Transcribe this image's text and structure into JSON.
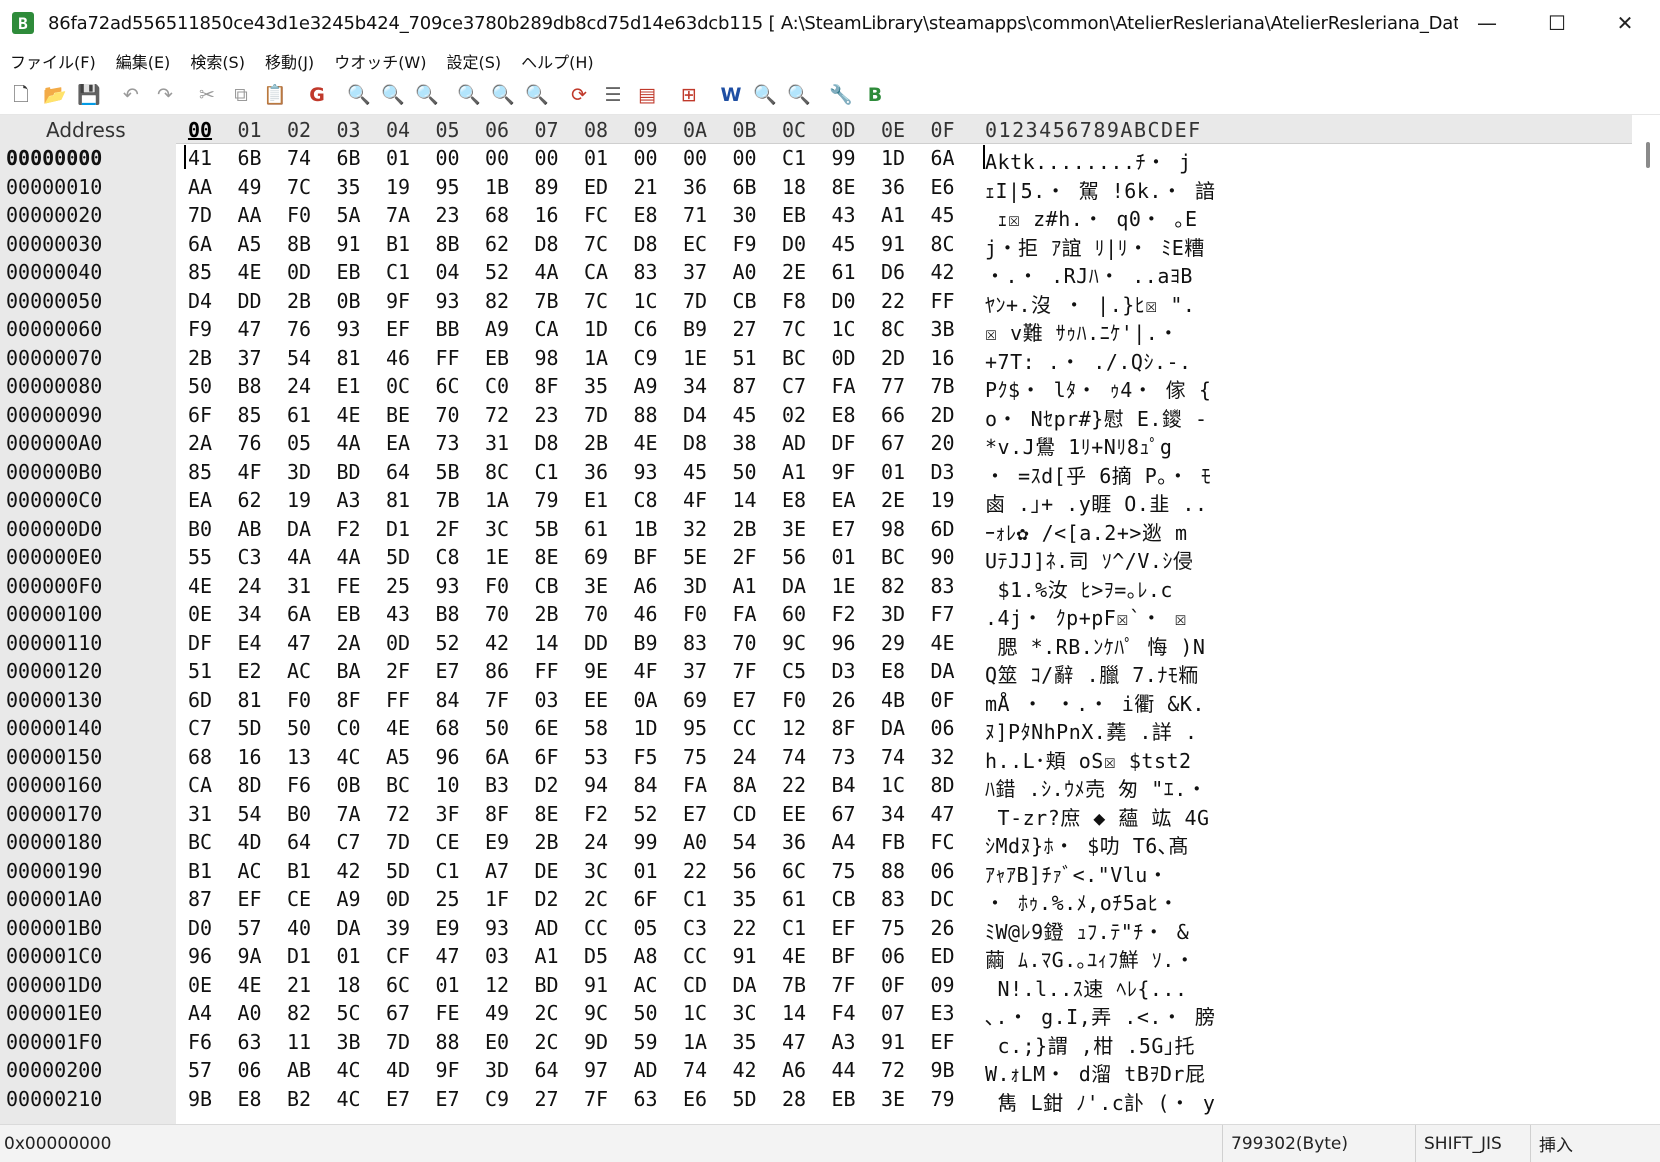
{
  "window": {
    "title": "86fa72ad556511850ce43d1e3245b424_709ce3780b289db8cd75d14e63dcb115 [ A:\\SteamLibrary\\steamapps\\common\\AtelierResleriana\\AtelierResleriana_Data\\ABCache\\Bundl...",
    "app_icon": "B",
    "minimize": "—",
    "maximize": "☐",
    "close": "✕"
  },
  "menu": [
    "ファイル(F)",
    "編集(E)",
    "検索(S)",
    "移動(J)",
    "ウオッチ(W)",
    "設定(S)",
    "ヘルプ(H)"
  ],
  "toolbar": [
    {
      "icon": "new-file-icon",
      "glyph": "🗋",
      "color": "#333333"
    },
    {
      "icon": "open-folder-icon",
      "glyph": "📂",
      "color": "#c59a1a"
    },
    {
      "icon": "save-icon",
      "glyph": "💾",
      "color": "#777777"
    },
    {
      "icon": "sep"
    },
    {
      "icon": "undo-icon",
      "glyph": "↶",
      "color": "#9a9a9a"
    },
    {
      "icon": "redo-icon",
      "glyph": "↷",
      "color": "#9a9a9a"
    },
    {
      "icon": "sep"
    },
    {
      "icon": "cut-icon",
      "glyph": "✂",
      "color": "#9a9a9a"
    },
    {
      "icon": "copy-icon",
      "glyph": "⧉",
      "color": "#9a9a9a"
    },
    {
      "icon": "paste-icon",
      "glyph": "📋",
      "color": "#777777"
    },
    {
      "icon": "sep"
    },
    {
      "icon": "goto-icon",
      "glyph": "G",
      "color": "#c0392b"
    },
    {
      "icon": "sep"
    },
    {
      "icon": "find-icon",
      "glyph": "🔍",
      "color": "#1f4fa3"
    },
    {
      "icon": "find-next-icon",
      "glyph": "🔍",
      "color": "#9a9a9a"
    },
    {
      "icon": "find-prev-icon",
      "glyph": "🔍",
      "color": "#9a9a9a"
    },
    {
      "icon": "sep"
    },
    {
      "icon": "replace-icon",
      "glyph": "🔍",
      "color": "#c0392b"
    },
    {
      "icon": "replace-next-icon",
      "glyph": "🔍",
      "color": "#9a9a9a"
    },
    {
      "icon": "replace-prev-icon",
      "glyph": "🔍",
      "color": "#9a9a9a"
    },
    {
      "icon": "sep"
    },
    {
      "icon": "compare-icon",
      "glyph": "⟳",
      "color": "#c0392b"
    },
    {
      "icon": "list-icon",
      "glyph": "☰",
      "color": "#666666"
    },
    {
      "icon": "clipboard-icon",
      "glyph": "▤",
      "color": "#c0392b"
    },
    {
      "icon": "sep"
    },
    {
      "icon": "struct-icon",
      "glyph": "⊞",
      "color": "#c0392b"
    },
    {
      "icon": "sep"
    },
    {
      "icon": "watch-icon",
      "glyph": "W",
      "color": "#1f4fa3"
    },
    {
      "icon": "watch-find-icon",
      "glyph": "🔍",
      "color": "#9a9a9a"
    },
    {
      "icon": "watch-find2-icon",
      "glyph": "🔍",
      "color": "#9a9a9a"
    },
    {
      "icon": "sep"
    },
    {
      "icon": "settings-icon",
      "glyph": "🔧",
      "color": "#1f4fa3"
    },
    {
      "icon": "bz-icon",
      "glyph": "B",
      "color": "#2e8b3a"
    }
  ],
  "hex_header": {
    "address_label": "Address",
    "columns": [
      "00",
      "01",
      "02",
      "03",
      "04",
      "05",
      "06",
      "07",
      "08",
      "09",
      "0A",
      "0B",
      "0C",
      "0D",
      "0E",
      "0F"
    ],
    "ascii_label": "0123456789ABCDEF"
  },
  "rows": [
    {
      "addr": "00000000",
      "bytes": [
        "41",
        "6B",
        "74",
        "6B",
        "01",
        "00",
        "00",
        "00",
        "01",
        "00",
        "00",
        "00",
        "C1",
        "99",
        "1D",
        "6A"
      ],
      "ascii": "Aktk........ﾁ・ j"
    },
    {
      "addr": "00000010",
      "bytes": [
        "AA",
        "49",
        "7C",
        "35",
        "19",
        "95",
        "1B",
        "89",
        "ED",
        "21",
        "36",
        "6B",
        "18",
        "8E",
        "36",
        "E6"
      ],
      "ascii": "ｪI|5.・ 駕 !6k.・ 諳"
    },
    {
      "addr": "00000020",
      "bytes": [
        "7D",
        "AA",
        "F0",
        "5A",
        "7A",
        "23",
        "68",
        "16",
        "FC",
        "E8",
        "71",
        "30",
        "EB",
        "43",
        "A1",
        "45"
      ],
      "ascii": " ｪ☒ z#h.・ q0・ ｡E"
    },
    {
      "addr": "00000030",
      "bytes": [
        "6A",
        "A5",
        "8B",
        "91",
        "B1",
        "8B",
        "62",
        "D8",
        "7C",
        "D8",
        "EC",
        "F9",
        "D0",
        "45",
        "91",
        "8C"
      ],
      "ascii": "j・拒 ｱ誼 ﾘ|ﾘ・ ﾐE糟"
    },
    {
      "addr": "00000040",
      "bytes": [
        "85",
        "4E",
        "0D",
        "EB",
        "C1",
        "04",
        "52",
        "4A",
        "CA",
        "83",
        "37",
        "A0",
        "2E",
        "61",
        "D6",
        "42"
      ],
      "ascii": "・.・ .RJﾊ・ ..aﾖB"
    },
    {
      "addr": "00000050",
      "bytes": [
        "D4",
        "DD",
        "2B",
        "0B",
        "9F",
        "93",
        "82",
        "7B",
        "7C",
        "1C",
        "7D",
        "CB",
        "F8",
        "D0",
        "22",
        "FF"
      ],
      "ascii": "ﾔﾝ+.沒 ・ |.}ﾋ☒ \"."
    },
    {
      "addr": "00000060",
      "bytes": [
        "F9",
        "47",
        "76",
        "93",
        "EF",
        "BB",
        "A9",
        "CA",
        "1D",
        "C6",
        "B9",
        "27",
        "7C",
        "1C",
        "8C",
        "3B"
      ],
      "ascii": "☒ v難 ｻｩﾊ.ﾆｹ'|.・"
    },
    {
      "addr": "00000070",
      "bytes": [
        "2B",
        "37",
        "54",
        "81",
        "46",
        "FF",
        "EB",
        "98",
        "1A",
        "C9",
        "1E",
        "51",
        "BC",
        "0D",
        "2D",
        "16"
      ],
      "ascii": "+7T: .・ ./.Qｼ.-."
    },
    {
      "addr": "00000080",
      "bytes": [
        "50",
        "B8",
        "24",
        "E1",
        "0C",
        "6C",
        "C0",
        "8F",
        "35",
        "A9",
        "34",
        "87",
        "C7",
        "FA",
        "77",
        "7B"
      ],
      "ascii": "Pｸ$・ lﾀ・ ｩ4・ 傢 {"
    },
    {
      "addr": "00000090",
      "bytes": [
        "6F",
        "85",
        "61",
        "4E",
        "BE",
        "70",
        "72",
        "23",
        "7D",
        "88",
        "D4",
        "45",
        "02",
        "E8",
        "66",
        "2D"
      ],
      "ascii": "o・ Nｾpr#}慰 E.鑁 -"
    },
    {
      "addr": "000000A0",
      "bytes": [
        "2A",
        "76",
        "05",
        "4A",
        "EA",
        "73",
        "31",
        "D8",
        "2B",
        "4E",
        "D8",
        "38",
        "AD",
        "DF",
        "67",
        "20"
      ],
      "ascii": "*v.J鷽 1ﾘ+Nﾘ8ｭﾟg"
    },
    {
      "addr": "000000B0",
      "bytes": [
        "85",
        "4F",
        "3D",
        "BD",
        "64",
        "5B",
        "8C",
        "C1",
        "36",
        "93",
        "45",
        "50",
        "A1",
        "9F",
        "01",
        "D3"
      ],
      "ascii": "・ =ｽd[乎 6摘 P｡・ ﾓ"
    },
    {
      "addr": "000000C0",
      "bytes": [
        "EA",
        "62",
        "19",
        "A3",
        "81",
        "7B",
        "1A",
        "79",
        "E1",
        "C8",
        "4F",
        "14",
        "E8",
        "EA",
        "2E",
        "19"
      ],
      "ascii": "鹵 .｣+ .y睚 O.韭 .."
    },
    {
      "addr": "000000D0",
      "bytes": [
        "B0",
        "AB",
        "DA",
        "F2",
        "D1",
        "2F",
        "3C",
        "5B",
        "61",
        "1B",
        "32",
        "2B",
        "3E",
        "E7",
        "98",
        "6D"
      ],
      "ascii": "ｰｫﾚ✿ /<[a.2+>逖 m"
    },
    {
      "addr": "000000E0",
      "bytes": [
        "55",
        "C3",
        "4A",
        "4A",
        "5D",
        "C8",
        "1E",
        "8E",
        "69",
        "BF",
        "5E",
        "2F",
        "56",
        "01",
        "BC",
        "90"
      ],
      "ascii": "UﾃJJ]ﾈ.司 ｿ^/V.ｼ侵"
    },
    {
      "addr": "000000F0",
      "bytes": [
        "4E",
        "24",
        "31",
        "FE",
        "25",
        "93",
        "F0",
        "CB",
        "3E",
        "A6",
        "3D",
        "A1",
        "DA",
        "1E",
        "82",
        "83"
      ],
      "ascii": " $1.%汝 ﾋ>ｦ=｡ﾚ.c"
    },
    {
      "addr": "00000100",
      "bytes": [
        "0E",
        "34",
        "6A",
        "EB",
        "43",
        "B8",
        "70",
        "2B",
        "70",
        "46",
        "F0",
        "FA",
        "60",
        "F2",
        "3D",
        "F7"
      ],
      "ascii": ".4j・ ｸp+pF☒`・ ☒"
    },
    {
      "addr": "00000110",
      "bytes": [
        "DF",
        "E4",
        "47",
        "2A",
        "0D",
        "52",
        "42",
        "14",
        "DD",
        "B9",
        "83",
        "70",
        "9C",
        "96",
        "29",
        "4E"
      ],
      "ascii": " 腮 *.RB.ﾝｹﾊﾟ 悔 )N"
    },
    {
      "addr": "00000120",
      "bytes": [
        "51",
        "E2",
        "AC",
        "BA",
        "2F",
        "E7",
        "86",
        "FF",
        "9E",
        "4F",
        "37",
        "7F",
        "C5",
        "D3",
        "E8",
        "DA"
      ],
      "ascii": "Q筮 ｺ/辭 .臘 7.ﾅﾓ粫"
    },
    {
      "addr": "00000130",
      "bytes": [
        "6D",
        "81",
        "F0",
        "8F",
        "FF",
        "84",
        "7F",
        "03",
        "EE",
        "0A",
        "69",
        "E7",
        "F0",
        "26",
        "4B",
        "0F"
      ],
      "ascii": "mÅ ・ ・.・ i衢 &K."
    },
    {
      "addr": "00000140",
      "bytes": [
        "C7",
        "5D",
        "50",
        "C0",
        "4E",
        "68",
        "50",
        "6E",
        "58",
        "1D",
        "95",
        "CC",
        "12",
        "8F",
        "DA",
        "06"
      ],
      "ascii": "ﾇ]PﾀNhPnX.蕘 .詳 ."
    },
    {
      "addr": "00000150",
      "bytes": [
        "68",
        "16",
        "13",
        "4C",
        "A5",
        "96",
        "6A",
        "6F",
        "53",
        "F5",
        "75",
        "24",
        "74",
        "73",
        "74",
        "32"
      ],
      "ascii": "h..L･頬 oS☒ $tst2"
    },
    {
      "addr": "00000160",
      "bytes": [
        "CA",
        "8D",
        "F6",
        "0B",
        "BC",
        "10",
        "B3",
        "D2",
        "94",
        "84",
        "FA",
        "8A",
        "22",
        "B4",
        "1C",
        "8D"
      ],
      "ascii": "ﾊ錯 .ｼ.ｳﾒ売 匆 \"ｴ.・"
    },
    {
      "addr": "00000170",
      "bytes": [
        "31",
        "54",
        "B0",
        "7A",
        "72",
        "3F",
        "8F",
        "8E",
        "F2",
        "52",
        "E7",
        "CD",
        "EE",
        "67",
        "34",
        "47"
      ],
      "ascii": " T-zr?庶 ◆ 蘊 竑 4G"
    },
    {
      "addr": "00000180",
      "bytes": [
        "BC",
        "4D",
        "64",
        "C7",
        "7D",
        "CE",
        "E9",
        "2B",
        "24",
        "99",
        "A0",
        "54",
        "36",
        "A4",
        "FB",
        "FC"
      ],
      "ascii": "ｼMdﾇ}ﾎ・ $叻 T6､髙"
    },
    {
      "addr": "00000190",
      "bytes": [
        "B1",
        "AC",
        "B1",
        "42",
        "5D",
        "C1",
        "A7",
        "DE",
        "3C",
        "01",
        "22",
        "56",
        "6C",
        "75",
        "88",
        "06"
      ],
      "ascii": "ｱｬｱB]ﾁｧﾞ<.\"Vlu・"
    },
    {
      "addr": "000001A0",
      "bytes": [
        "87",
        "EF",
        "CE",
        "A9",
        "0D",
        "25",
        "1F",
        "D2",
        "2C",
        "6F",
        "C1",
        "35",
        "61",
        "CB",
        "83",
        "DC"
      ],
      "ascii": "・ ﾎｩ.%.ﾒ,oﾁ5aﾋ・"
    },
    {
      "addr": "000001B0",
      "bytes": [
        "D0",
        "57",
        "40",
        "DA",
        "39",
        "E9",
        "93",
        "AD",
        "CC",
        "05",
        "C3",
        "22",
        "C1",
        "EF",
        "75",
        "26"
      ],
      "ascii": "ﾐW@ﾚ9鐙 ｭﾌ.ﾃ\"ﾁ・ &"
    },
    {
      "addr": "000001C0",
      "bytes": [
        "96",
        "9A",
        "D1",
        "01",
        "CF",
        "47",
        "03",
        "A1",
        "D5",
        "A8",
        "CC",
        "91",
        "4E",
        "BF",
        "06",
        "ED"
      ],
      "ascii": "繭 ﾑ.ﾏG.｡ﾕｨﾌ鮮 ｿ.・"
    },
    {
      "addr": "000001D0",
      "bytes": [
        "0E",
        "4E",
        "21",
        "18",
        "6C",
        "01",
        "12",
        "BD",
        "91",
        "AC",
        "CD",
        "DA",
        "7B",
        "7F",
        "0F",
        "09"
      ],
      "ascii": " N!.l..ｽ速 ﾍﾚ{..."
    },
    {
      "addr": "000001E0",
      "bytes": [
        "A4",
        "A0",
        "82",
        "5C",
        "67",
        "FE",
        "49",
        "2C",
        "9C",
        "50",
        "1C",
        "3C",
        "14",
        "F4",
        "07",
        "E3"
      ],
      "ascii": "､.・ g.I,弄 .<.・ 膀"
    },
    {
      "addr": "000001F0",
      "bytes": [
        "F6",
        "63",
        "11",
        "3B",
        "7D",
        "88",
        "E0",
        "2C",
        "9D",
        "59",
        "1A",
        "35",
        "47",
        "A3",
        "91",
        "EF"
      ],
      "ascii": " c.;}謂 ,柑 .5G｣托"
    },
    {
      "addr": "00000200",
      "bytes": [
        "57",
        "06",
        "AB",
        "4C",
        "4D",
        "9F",
        "3D",
        "64",
        "97",
        "AD",
        "74",
        "42",
        "A6",
        "44",
        "72",
        "9B"
      ],
      "ascii": "W.ｫLM・ d溜 tBｦDr屁"
    },
    {
      "addr": "00000210",
      "bytes": [
        "9B",
        "E8",
        "B2",
        "4C",
        "E7",
        "E7",
        "C9",
        "27",
        "7F",
        "63",
        "E6",
        "5D",
        "28",
        "EB",
        "3E",
        "79"
      ],
      "ascii": " 雋 L鉗 ﾉ'.c訃 (・ y"
    }
  ],
  "status": {
    "position": "0x00000000",
    "size": "799302(Byte)",
    "encoding": "SHIFT_JIS",
    "mode": "挿入"
  }
}
